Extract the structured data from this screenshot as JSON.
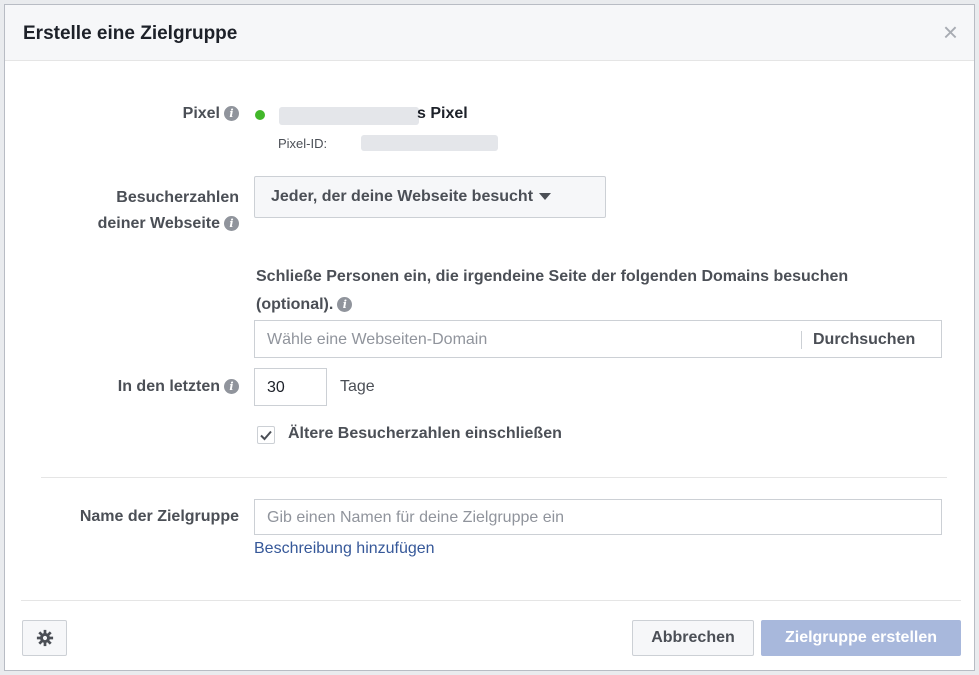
{
  "dialog": {
    "title": "Erstelle eine Zielgruppe",
    "close_icon": "×"
  },
  "pixel": {
    "label": "Pixel",
    "name_suffix": "s Pixel",
    "id_label": "Pixel-ID:",
    "status_color": "#42b72a"
  },
  "visitors": {
    "label_line1": "Besucherzahlen",
    "label_line2": "deiner Webseite",
    "dropdown_value": "Jeder, der deine Webseite besucht"
  },
  "domains": {
    "description_line1": "Schließe Personen ein, die irgendeine Seite der folgenden Domains besuchen",
    "description_line2": "(optional).",
    "input_placeholder": "Wähle eine Webseiten-Domain",
    "browse_label": "Durchsuchen"
  },
  "days": {
    "label": "In den letzten",
    "value": "30",
    "unit": "Tage"
  },
  "older": {
    "checked": true,
    "label": "Ältere Besucherzahlen einschließen"
  },
  "audience_name": {
    "label": "Name der Zielgruppe",
    "placeholder": "Gib einen Namen für deine Zielgruppe ein",
    "add_description": "Beschreibung hinzufügen"
  },
  "footer": {
    "cancel_label": "Abbrechen",
    "create_label": "Zielgruppe erstellen"
  },
  "colors": {
    "link": "#365899",
    "primary_disabled": "#a8b8dc"
  }
}
